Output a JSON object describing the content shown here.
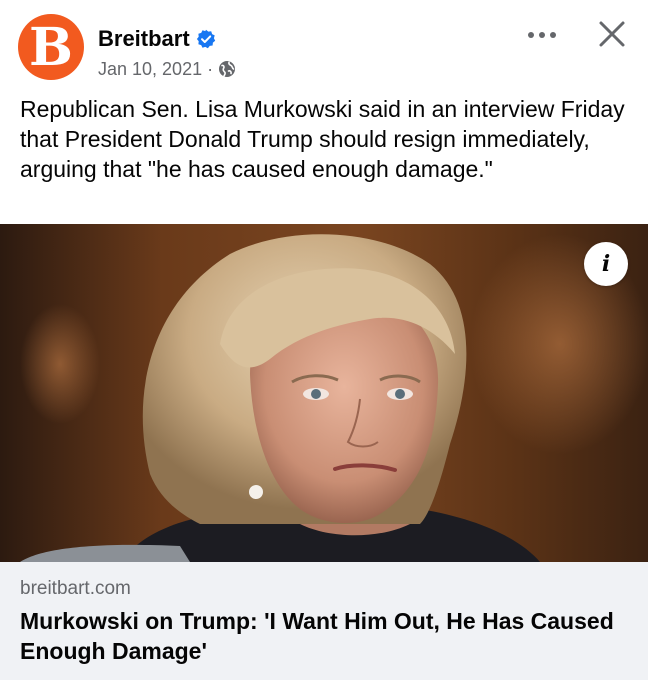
{
  "post": {
    "page_name": "Breitbart",
    "avatar_letter": "B",
    "date": "Jan 10, 2021",
    "meta_separator": "·",
    "privacy_icon": "globe-icon",
    "verified_icon": "verified-badge-icon",
    "more_icon": "more-options-icon",
    "close_icon": "close-icon",
    "text": "Republican Sen. Lisa Murkowski said in an interview Friday that President Donald Trump should resign immediately, arguing that \"he has caused enough damage.\"",
    "colors": {
      "brand_orange": "#f25a1f",
      "verified_blue": "#1877f2",
      "secondary_text": "#65676b",
      "link_background": "#f0f2f5"
    }
  },
  "photo": {
    "info_label": "i",
    "info_icon": "info-icon"
  },
  "link_preview": {
    "domain": "breitbart.com",
    "title": "Murkowski on Trump: 'I Want Him Out, He Has Caused Enough Damage'"
  }
}
